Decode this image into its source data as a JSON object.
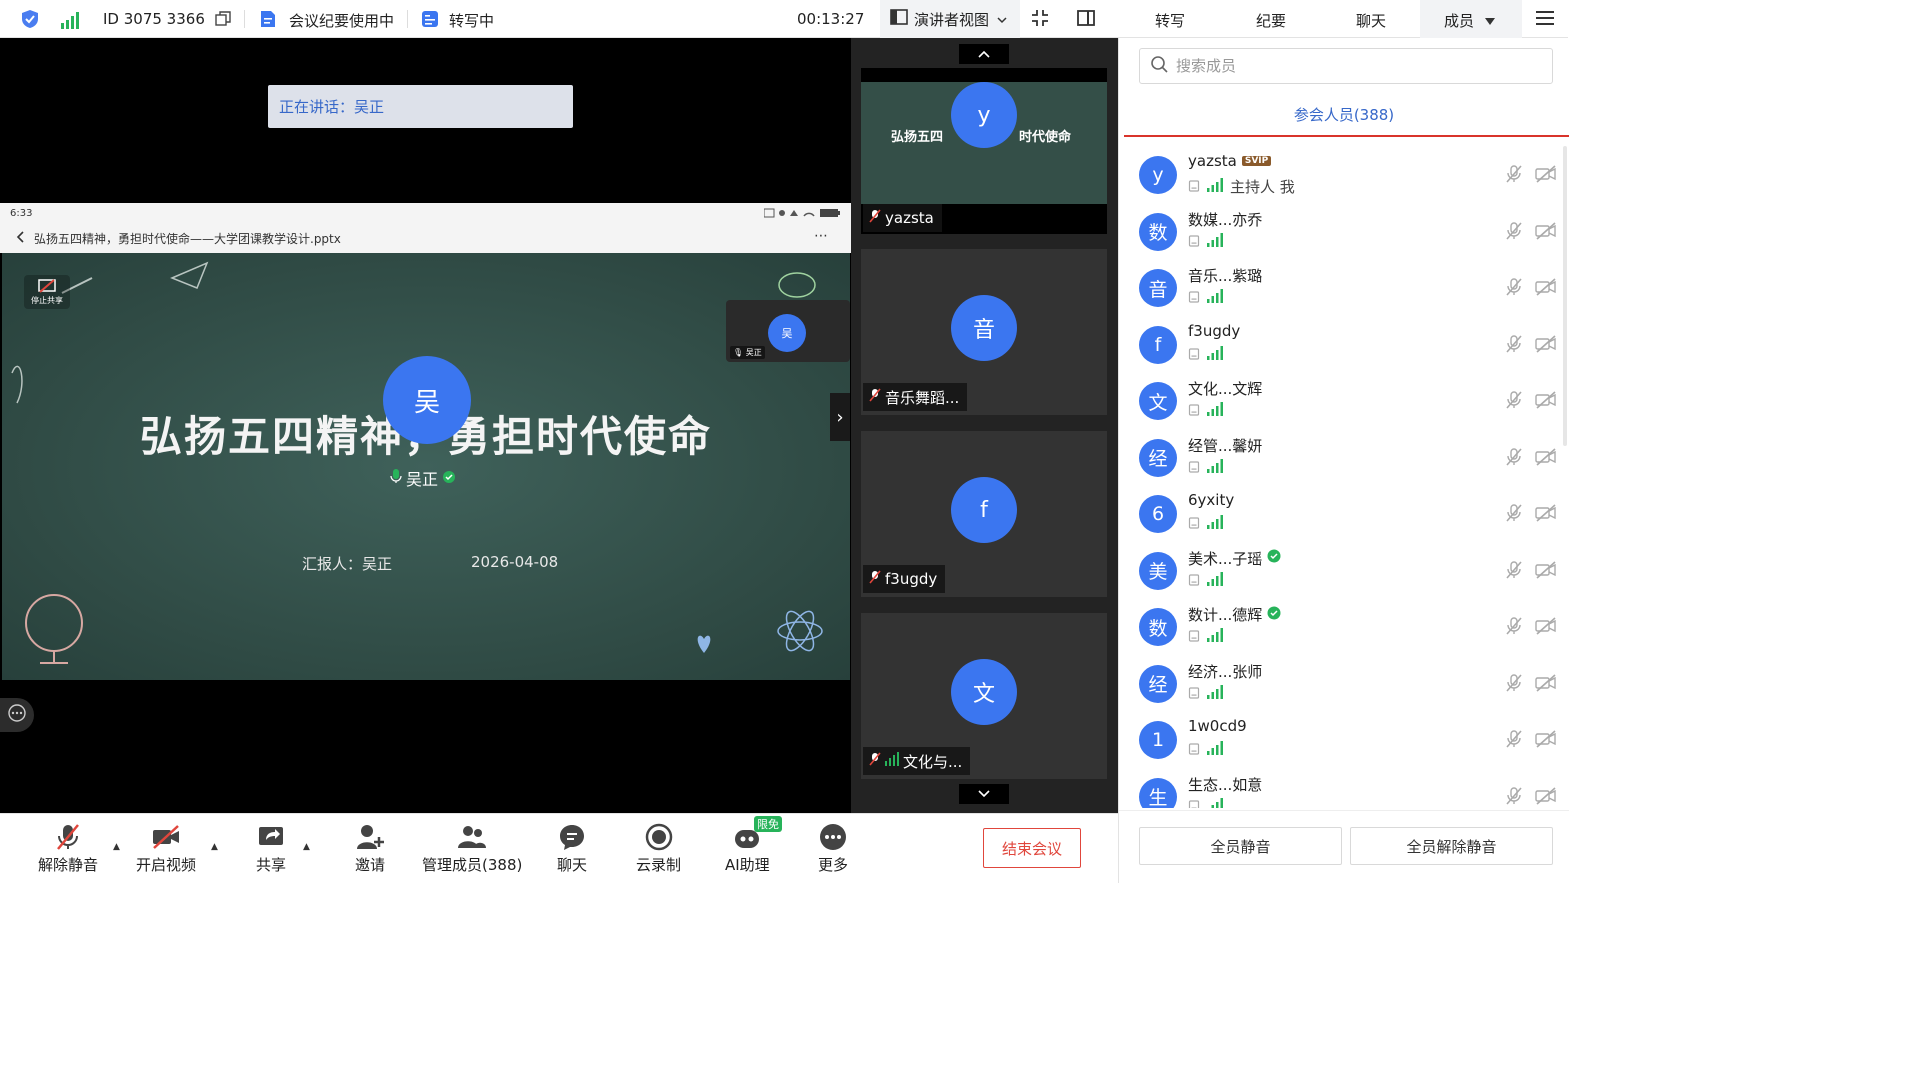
{
  "topbar": {
    "meeting_id": "ID 3075 3366",
    "minutes_status": "会议纪要使用中",
    "transcribe_status": "转写中",
    "timer": "00:13:27",
    "view_mode": "演讲者视图"
  },
  "right_tabs": [
    "转写",
    "纪要",
    "聊天",
    "成员"
  ],
  "stage": {
    "speaking_banner": "正在讲话：吴正",
    "phone_time": "6:33",
    "file_title": "弘扬五四精神，勇担时代使命——大学团课教学设计.pptx",
    "stop_share_label": "停止共享",
    "slide_title": "弘扬五四精神，勇担时代使命",
    "presenter_label": "汇报人：吴正",
    "slide_date": "2026-04-08",
    "speaker_avatar": "吴",
    "speaker_name": "吴正",
    "mini_avatar": "吴",
    "mini_name": "吴正"
  },
  "gallery": [
    {
      "avatar": "y",
      "name": "yazsta",
      "shot_title": "弘扬五四",
      "shot_title2": "时代使命"
    },
    {
      "avatar": "音",
      "name": "音乐舞蹈..."
    },
    {
      "avatar": "f",
      "name": "f3ugdy"
    },
    {
      "avatar": "文",
      "name": "文化与..."
    }
  ],
  "toolbar": {
    "unmute": "解除静音",
    "start_video": "开启视频",
    "share": "共享",
    "invite": "邀请",
    "manage": "管理成员(388)",
    "chat": "聊天",
    "record": "云录制",
    "ai": "AI助理",
    "ai_badge": "限免",
    "more": "更多",
    "end": "结束会议"
  },
  "panel": {
    "search_placeholder": "搜索成员",
    "attendees": "参会人员(388)",
    "mute_all": "全员静音",
    "unmute_all": "全员解除静音",
    "members": [
      {
        "avatar": "y",
        "name": "yazsta",
        "badge": "SVIP",
        "role": "主持人 我",
        "verified": false
      },
      {
        "avatar": "数",
        "name": "数媒...亦乔",
        "role": "",
        "verified": false
      },
      {
        "avatar": "音",
        "name": "音乐...紫璐",
        "role": "",
        "verified": false
      },
      {
        "avatar": "f",
        "name": "f3ugdy",
        "role": "",
        "verified": false
      },
      {
        "avatar": "文",
        "name": "文化...文辉",
        "role": "",
        "verified": false
      },
      {
        "avatar": "经",
        "name": "经管...馨妍",
        "role": "",
        "verified": false
      },
      {
        "avatar": "6",
        "name": "6yxity",
        "role": "",
        "verified": false
      },
      {
        "avatar": "美",
        "name": "美术...子瑶",
        "role": "",
        "verified": true
      },
      {
        "avatar": "数",
        "name": "数计...德辉",
        "role": "",
        "verified": true
      },
      {
        "avatar": "经",
        "name": "经济...张师",
        "role": "",
        "verified": false
      },
      {
        "avatar": "1",
        "name": "1w0cd9",
        "role": "",
        "verified": false
      },
      {
        "avatar": "生",
        "name": "生态...如意",
        "role": "",
        "verified": false
      }
    ]
  },
  "colors": {
    "accent": "#3b76f0",
    "danger": "#e0463c",
    "signal": "#27b35a"
  }
}
